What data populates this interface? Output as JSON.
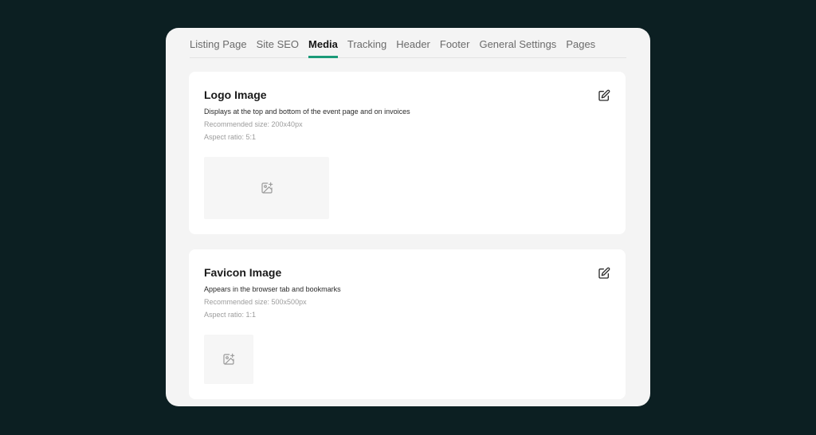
{
  "tabs": [
    {
      "label": "Listing Page"
    },
    {
      "label": "Site SEO"
    },
    {
      "label": "Media",
      "active": true
    },
    {
      "label": "Tracking"
    },
    {
      "label": "Header"
    },
    {
      "label": "Footer"
    },
    {
      "label": "General Settings"
    },
    {
      "label": "Pages"
    }
  ],
  "logo_card": {
    "title": "Logo Image",
    "description": "Displays at the top and bottom of the event page and on invoices",
    "recommended_size": "Recommended size: 200x40px",
    "aspect_ratio": "Aspect ratio: 5:1",
    "edit_icon": "edit-icon",
    "placeholder_icon": "image-plus-icon"
  },
  "favicon_card": {
    "title": "Favicon Image",
    "description": "Appears in the browser tab and bookmarks",
    "recommended_size": "Recommended size: 500x500px",
    "aspect_ratio": "Aspect ratio: 1:1",
    "edit_icon": "edit-icon",
    "placeholder_icon": "image-plus-icon"
  },
  "colors": {
    "background": "#0c1f22",
    "accent": "#1a9a78",
    "panel": "#f4f4f4"
  }
}
